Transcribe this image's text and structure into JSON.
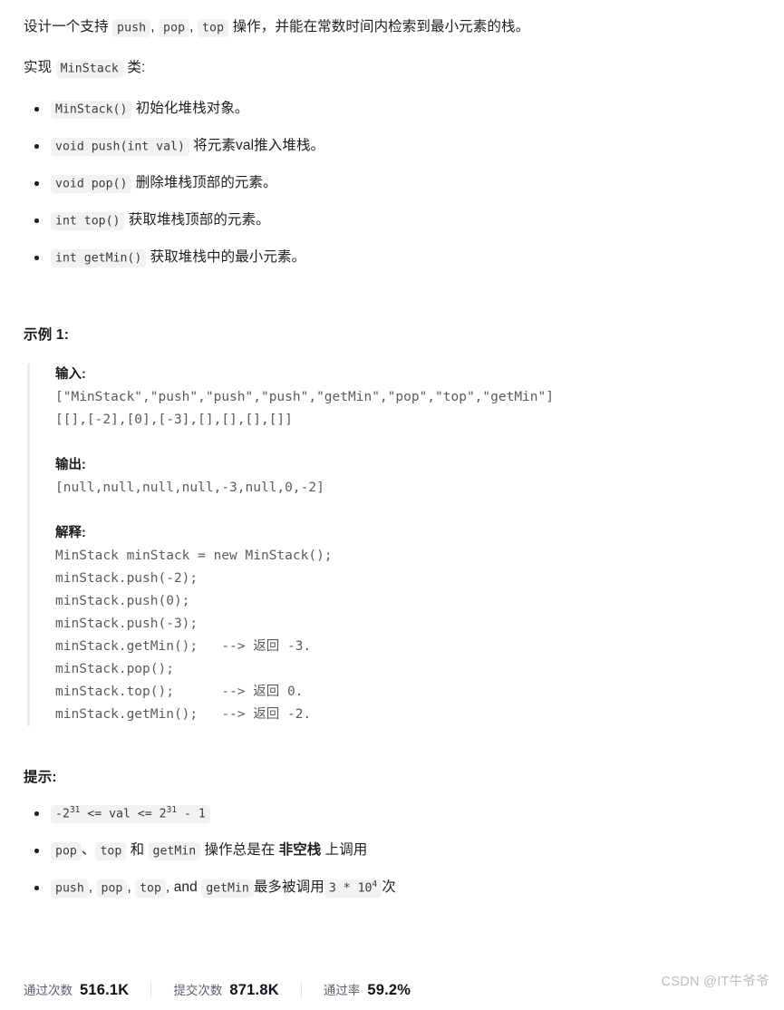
{
  "intro": {
    "line1_part1": "设计一个支持",
    "line1_code1": "push",
    "line1_sep1": ",",
    "line1_code2": "pop",
    "line1_sep2": ",",
    "line1_code3": "top",
    "line1_part2": "操作，并能在常数时间内检索到最小元素的栈。",
    "line2_part1": "实现",
    "line2_code": "MinStack",
    "line2_part2": "类:"
  },
  "api_list": [
    {
      "code": "MinStack()",
      "text": "初始化堆栈对象。"
    },
    {
      "code": "void push(int val)",
      "text": "将元素val推入堆栈。"
    },
    {
      "code": "void pop()",
      "text": "删除堆栈顶部的元素。"
    },
    {
      "code": "int top()",
      "text": "获取堆栈顶部的元素。"
    },
    {
      "code": "int getMin()",
      "text": "获取堆栈中的最小元素。"
    }
  ],
  "example": {
    "heading": "示例 1:",
    "input_label": "输入:",
    "input_lines": "[\"MinStack\",\"push\",\"push\",\"push\",\"getMin\",\"pop\",\"top\",\"getMin\"]\n[[],[-2],[0],[-3],[],[],[],[]]",
    "output_label": "输出:",
    "output_lines": "[null,null,null,null,-3,null,0,-2]",
    "explain_label": "解释:",
    "explain_lines": "MinStack minStack = new MinStack();\nminStack.push(-2);\nminStack.push(0);\nminStack.push(-3);\nminStack.getMin();   --> 返回 -3.\nminStack.pop();\nminStack.top();      --> 返回 0.\nminStack.getMin();   --> 返回 -2."
  },
  "hints": {
    "heading": "提示:",
    "item1": {
      "base_neg": "-2",
      "exp1": "31",
      "mid": " <= val <= 2",
      "exp2": "31",
      "tail": " - 1"
    },
    "item2": {
      "code1": "pop",
      "sep1": "、",
      "code2": "top",
      "sep2": "和",
      "code3": "getMin",
      "text1": "操作总是在",
      "bold": "非空栈",
      "text2": "上调用"
    },
    "item3": {
      "code1": "push",
      "sep1": ",",
      "code2": "pop",
      "sep2": ",",
      "code3": "top",
      "sep3": ", and",
      "code4": "getMin",
      "text1": "最多被调用",
      "code5_base": "3 * 10",
      "code5_exp": "4",
      "text2": "次"
    }
  },
  "stats": [
    {
      "label": "通过次数",
      "value": "516.1K"
    },
    {
      "label": "提交次数",
      "value": "871.8K"
    },
    {
      "label": "通过率",
      "value": "59.2%"
    }
  ],
  "watermark": "CSDN @IT牛爷爷"
}
